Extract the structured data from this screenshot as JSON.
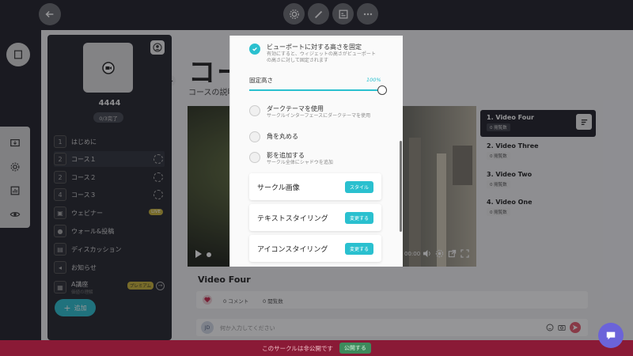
{
  "sidebar": {
    "title": "4444",
    "progress": "0/3完了",
    "items": [
      {
        "num": "1",
        "label": "はじめに"
      },
      {
        "num": "2",
        "label": "コース１"
      },
      {
        "num": "2",
        "label": "コース２"
      },
      {
        "num": "4",
        "label": "コース３"
      },
      {
        "label": "ウェビナー",
        "badge": "LIVE"
      },
      {
        "label": "ウォール&投稿"
      },
      {
        "label": "ディスカッション"
      },
      {
        "label": "お知らせ"
      },
      {
        "label": "A講座",
        "sub": "価値の理解",
        "badge": "プレミアム"
      }
    ],
    "add_button": "追加"
  },
  "main": {
    "title_partial": "コー",
    "desc_partial": "コースの説明",
    "video_time": "00:00",
    "video_title": "Video Four",
    "comments": "0 コメント",
    "views": "0 閲覧数",
    "comment_placeholder": "何か入力してください",
    "avatar_initials": "JD"
  },
  "videos": [
    {
      "title": "1. Video Four",
      "badge": "0 閲覧数"
    },
    {
      "title": "2. Video Three",
      "badge": "0 閲覧数"
    },
    {
      "title": "3. Video Two",
      "badge": "0 閲覧数"
    },
    {
      "title": "4. Video One",
      "badge": "0 閲覧数"
    }
  ],
  "modal": {
    "viewport_title": "ビューポートに対する高さを固定",
    "viewport_desc1": "有効にすると、ウィジェットの高さがビューポート",
    "viewport_desc2": "の高さに対して固定されます",
    "height_label": "固定高さ",
    "height_value": "100%",
    "height_fraction": 1.0,
    "dark_title": "ダークテーマを使用",
    "dark_desc": "サークルインターフェースにダークテーマを使用",
    "round_title": "角を丸める",
    "shadow_title": "影を追加する",
    "shadow_desc": "サークル全体にシャドウを追加",
    "cards": [
      {
        "label": "サークル画像",
        "button": "スタイル"
      },
      {
        "label": "テキストスタイリング",
        "button": "変更する"
      },
      {
        "label": "アイコンスタイリング",
        "button": "変更する"
      }
    ]
  },
  "footer": {
    "notice": "このサークルは非公開です",
    "publish": "公開する"
  },
  "colors": {
    "accent": "#2ac0cf",
    "footer": "#8a1a36",
    "badge": "#c9b23a"
  }
}
